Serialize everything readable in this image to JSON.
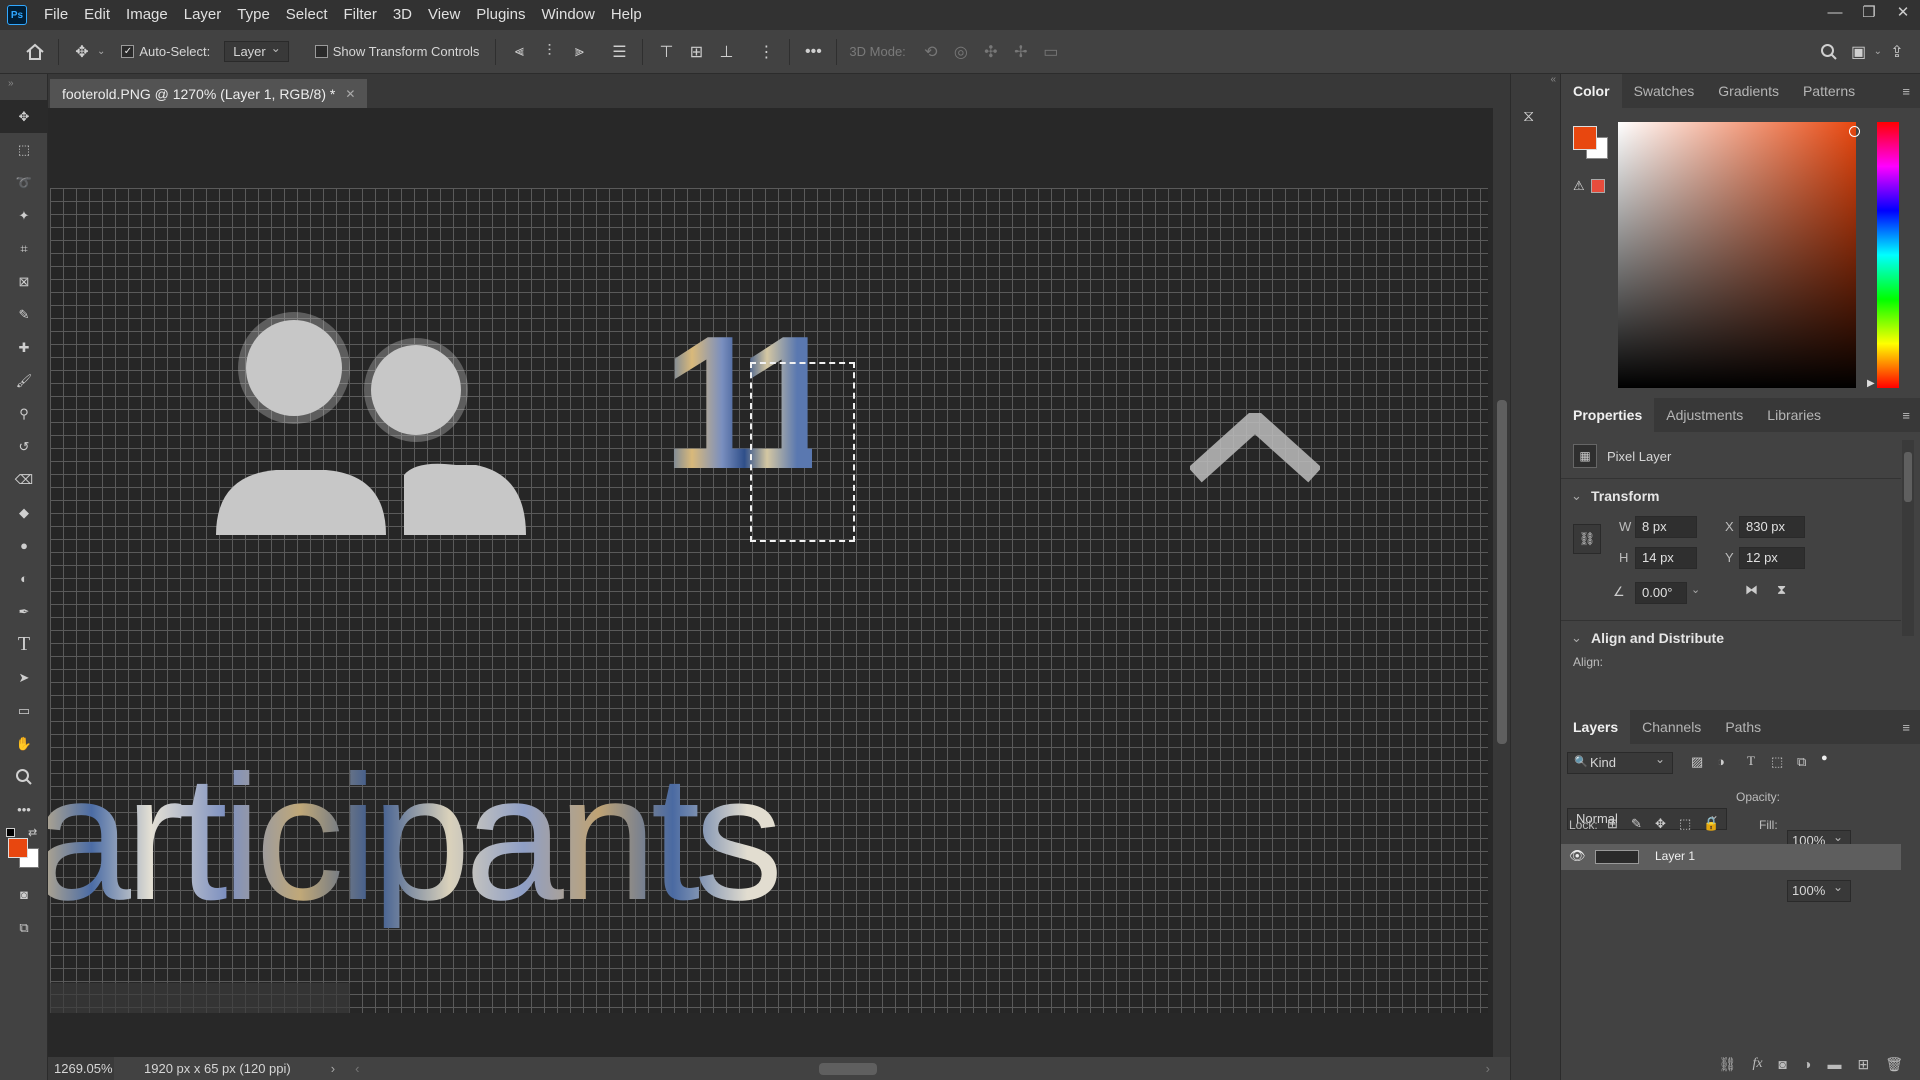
{
  "app": {
    "logo_text": "Ps"
  },
  "menu": [
    "File",
    "Edit",
    "Image",
    "Layer",
    "Type",
    "Select",
    "Filter",
    "3D",
    "View",
    "Plugins",
    "Window",
    "Help"
  ],
  "options_bar": {
    "auto_select_label": "Auto-Select:",
    "auto_select_value": "Layer",
    "show_transform_label": "Show Transform Controls",
    "mode_3d_label": "3D Mode:"
  },
  "document": {
    "tab_title": "footerold.PNG @ 1270% (Layer 1, RGB/8) *",
    "canvas_text": "articipants",
    "canvas_digit": "11"
  },
  "status": {
    "zoom": "1269.05%",
    "doc_info": "1920 px x 65 px (120 ppi)"
  },
  "color_panel": {
    "tabs": [
      "Color",
      "Swatches",
      "Gradients",
      "Patterns"
    ],
    "foreground": "#e8470f",
    "background": "#ffffff",
    "web_safe_warning": "#e74c3c"
  },
  "properties_panel": {
    "tabs": [
      "Properties",
      "Adjustments",
      "Libraries"
    ],
    "layer_type": "Pixel Layer",
    "transform_heading": "Transform",
    "w_label": "W",
    "w_value": "8 px",
    "h_label": "H",
    "h_value": "14 px",
    "x_label": "X",
    "x_value": "830 px",
    "y_label": "Y",
    "y_value": "12 px",
    "angle_value": "0.00°",
    "align_heading": "Align and Distribute",
    "align_label": "Align:"
  },
  "layers_panel": {
    "tabs": [
      "Layers",
      "Channels",
      "Paths"
    ],
    "filter_kind": "Kind",
    "blend_mode": "Normal",
    "opacity_label": "Opacity:",
    "opacity_value": "100%",
    "lock_label": "Lock:",
    "fill_label": "Fill:",
    "fill_value": "100%",
    "layers": [
      {
        "name": "Layer 1"
      }
    ]
  }
}
